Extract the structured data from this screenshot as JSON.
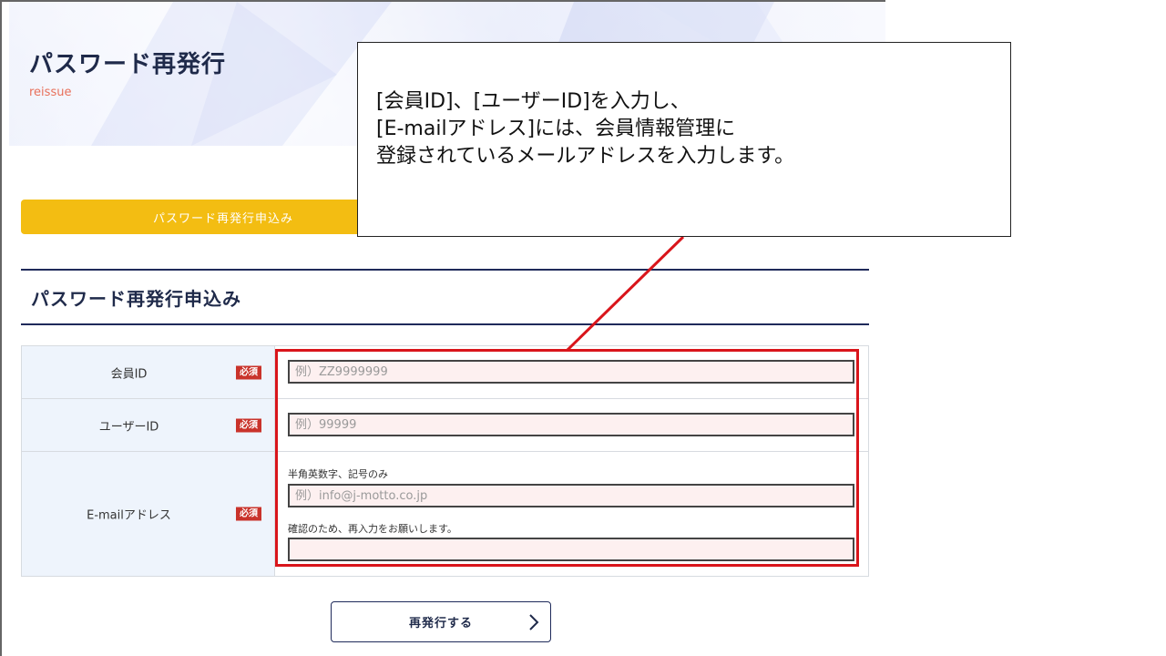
{
  "header": {
    "title": "パスワード再発行",
    "subtitle": "reissue"
  },
  "steps": {
    "current_tab": "パスワード再発行申込み"
  },
  "section": {
    "title": "パスワード再発行申込み"
  },
  "form": {
    "required_badge": "必須",
    "member_id": {
      "label": "会員ID",
      "placeholder": "例）ZZ9999999"
    },
    "user_id": {
      "label": "ユーザーID",
      "placeholder": "例）99999"
    },
    "email": {
      "label": "E-mailアドレス",
      "hint": "半角英数字、記号のみ",
      "placeholder": "例）info@j-motto.co.jp",
      "confirm_hint": "確認のため、再入力をお願いします。",
      "confirm_value": ""
    }
  },
  "submit": {
    "label": "再発行する"
  },
  "annotation": {
    "lines": [
      "[会員ID]、[ユーザーID]を入力し、",
      "[E-mailアドレス]には、会員情報管理に",
      "登録されているメールアドレスを入力します。"
    ],
    "highlight_color": "#d9151b"
  },
  "colors": {
    "accent_yellow": "#f3bd12",
    "navy": "#1f2a4a",
    "required_red": "#c9332b",
    "subtitle_orange": "#e8705a",
    "input_bg": "#fdf0f0"
  }
}
